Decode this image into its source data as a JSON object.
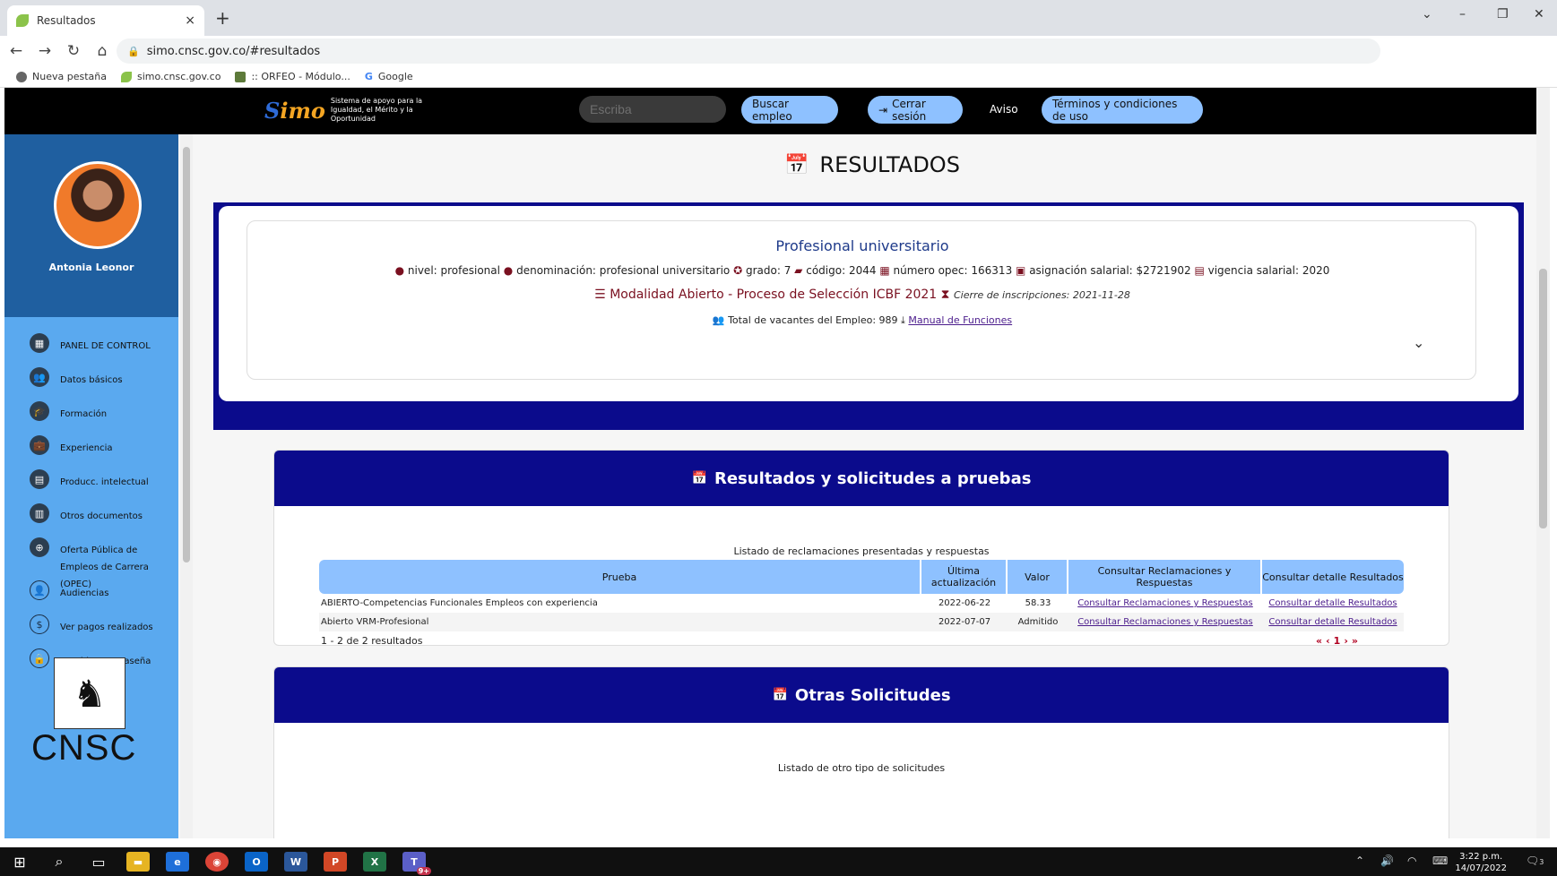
{
  "browser": {
    "tab_title": "Resultados",
    "tab_close": "×",
    "new_tab": "+",
    "url": "simo.cnsc.gov.co/#resultados",
    "bookmarks": [
      "Nueva pestaña",
      "simo.cnsc.gov.co",
      ":: ORFEO - Módulo...",
      "Google"
    ]
  },
  "header": {
    "brand_logo_prefix": "S",
    "brand_logo": "imo",
    "brand_tagline": "Sistema de apoyo para la Igualdad, el Mérito y la Oportunidad",
    "search_placeholder": "Escriba",
    "buscar_label": "Buscar empleo",
    "cerrar_label": "Cerrar sesión",
    "aviso_label": "Aviso",
    "terminos_label": "Términos y condiciones de uso"
  },
  "sidebar": {
    "user_name": "Antonia Leonor",
    "items": [
      {
        "label": "PANEL DE CONTROL",
        "icon": "▦"
      },
      {
        "label": "Datos básicos",
        "icon": "👥"
      },
      {
        "label": "Formación",
        "icon": "🎓"
      },
      {
        "label": "Experiencia",
        "icon": "💼"
      },
      {
        "label": "Producc. intelectual",
        "icon": "▤"
      },
      {
        "label": "Otros documentos",
        "icon": "▥"
      },
      {
        "label": "Oferta Pública de Empleos de Carrera (OPEC)",
        "icon": "⊕"
      },
      {
        "label": "Audiencias",
        "icon": "👤"
      },
      {
        "label": "Ver pagos realizados",
        "icon": "$"
      },
      {
        "label": "Cambiar contraseña",
        "icon": "🔒"
      }
    ],
    "org_name": "CNSC"
  },
  "main": {
    "page_title": "RESULTADOS",
    "job": {
      "title": "Profesional universitario",
      "nivel": "nivel: profesional",
      "denominacion": "denominación: profesional universitario",
      "grado": "grado: 7",
      "codigo": "código: 2044",
      "opec": "número opec: 166313",
      "asignacion": "asignación salarial: $2721902",
      "vigencia": "vigencia salarial: 2020",
      "modalidad": "Modalidad Abierto - Proceso de Selección ICBF 2021",
      "cierre": "Cierre de inscripciones: 2021-11-28",
      "vacantes": "Total de vacantes del Empleo: 989",
      "manual_link": "Manual de Funciones"
    },
    "results_panel": {
      "title": "Resultados y solicitudes a pruebas",
      "caption": "Listado de reclamaciones presentadas y respuestas",
      "columns": [
        "Prueba",
        "Última actualización",
        "Valor",
        "Consultar Reclamaciones y Respuestas",
        "Consultar detalle Resultados"
      ],
      "rows": [
        {
          "prueba": "ABIERTO-Competencias Funcionales Empleos con experiencia",
          "fecha": "2022-06-22",
          "valor": "58.33",
          "reclamaciones": "Consultar Reclamaciones y Respuestas",
          "detalle": "Consultar detalle Resultados"
        },
        {
          "prueba": "Abierto VRM-Profesional",
          "fecha": "2022-07-07",
          "valor": "Admitido",
          "reclamaciones": "Consultar Reclamaciones y Respuestas",
          "detalle": "Consultar detalle Resultados"
        }
      ],
      "count": "1 - 2 de 2 resultados",
      "pager": [
        "«",
        "‹",
        "1",
        "›",
        "»"
      ]
    },
    "other_panel": {
      "title": "Otras Solicitudes",
      "caption": "Listado de otro tipo de solicitudes"
    }
  },
  "taskbar": {
    "time": "3:22 p.m.",
    "date": "14/07/2022",
    "teams_badge": "9+",
    "notif_count": "3"
  }
}
